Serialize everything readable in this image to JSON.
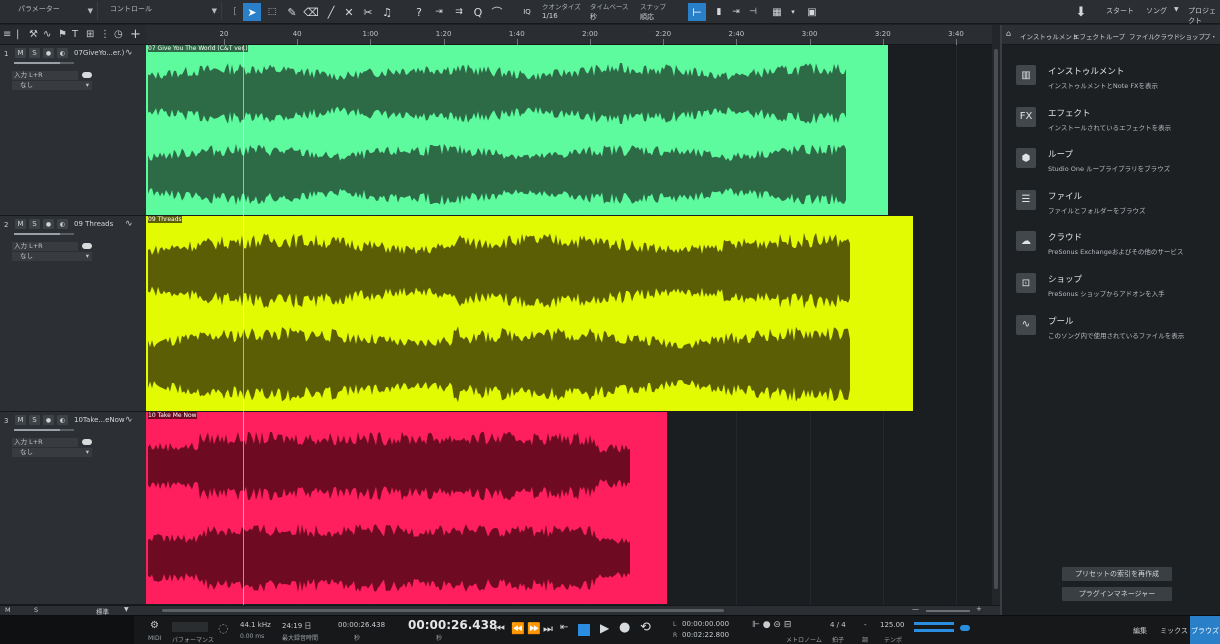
{
  "toolbar": {
    "params_label": "パラメーター",
    "control_label": "コントロール",
    "quantize_label": "クオンタイズ",
    "quantize_value": "1/16",
    "timebase_label": "タイムベース",
    "timebase_value": "秒",
    "snap_label": "スナップ",
    "snap_value": "順応",
    "iq_label": "IQ",
    "nav_start": "スタート",
    "nav_song": "ソング",
    "nav_project": "プロジェクト"
  },
  "ruler": {
    "ticks": [
      "20",
      "40",
      "1:00",
      "1:20",
      "1:40",
      "2:00",
      "2:20",
      "2:40",
      "3:00",
      "3:20",
      "3:40"
    ]
  },
  "tracks": [
    {
      "num": "1",
      "name": "07GiveYo...er.)",
      "input": "入力 L+R",
      "output": "なし",
      "clip_title": "07 Give You The World (C&T ver.)",
      "color": "#5dfa9e",
      "dark": "#2d6b47"
    },
    {
      "num": "2",
      "name": "09 Threads",
      "input": "入力 L+R",
      "output": "なし",
      "clip_title": "09 Threads",
      "color": "#e2fb02",
      "dark": "#5c5e05"
    },
    {
      "num": "3",
      "name": "10Take...eNow",
      "input": "入力 L+R",
      "output": "なし",
      "clip_title": "10 Take Me Now",
      "color": "#ff1f5e",
      "dark": "#6e0a22"
    }
  ],
  "track_buttons": {
    "mute": "M",
    "solo": "S",
    "rec": "●",
    "monitor": "◐"
  },
  "browser": {
    "tabs": [
      "インストゥルメント",
      "エフェクト",
      "ループ",
      "ファイル",
      "クラウド",
      "ショップ",
      "プ・"
    ],
    "items": [
      {
        "icon": "piano-icon",
        "title": "インストゥルメント",
        "desc": "インストゥルメントとNote FXを表示"
      },
      {
        "icon": "fx-icon",
        "title": "エフェクト",
        "desc": "インストールされているエフェクトを表示"
      },
      {
        "icon": "loop-icon",
        "title": "ループ",
        "desc": "Studio One ループライブラリをブラウズ"
      },
      {
        "icon": "file-icon",
        "title": "ファイル",
        "desc": "ファイルとフォルダーをブラウズ"
      },
      {
        "icon": "cloud-icon",
        "title": "クラウド",
        "desc": "PreSonus Exchangeおよびその他のサービス"
      },
      {
        "icon": "shop-icon",
        "title": "ショップ",
        "desc": "PreSonus ショップからアドオンを入手"
      },
      {
        "icon": "pool-icon",
        "title": "プール",
        "desc": "このソング内で使用されているファイルを表示"
      }
    ],
    "fx_glyph": "FX",
    "btn_reindex": "プリセットの索引を再作成",
    "btn_plugin_manager": "プラグインマネージャー"
  },
  "lowerbar": {
    "m": "M",
    "s": "S",
    "zoom": "標準"
  },
  "transport": {
    "midi": "MIDI",
    "performance": "パフォーマンス",
    "sample_rate": "44.1 kHz",
    "latency": "0.00 ms",
    "rec_time": "24:19 日",
    "rec_time_label": "最大録音時間",
    "pos_small": "00:00:26.438",
    "pos_small_unit": "秒",
    "pos_main": "00:00:26.438",
    "pos_main_unit": "秒",
    "loop_l": "00:00:00.000",
    "loop_r": "00:02:22.800",
    "l_label": "L",
    "r_label": "R",
    "metronome": "メトロノーム",
    "timesig": "4 / 4",
    "timesig_label": "拍子",
    "key": "-",
    "key_label": "調",
    "tempo": "125.00",
    "tempo_label": "テンポ",
    "nav_edit": "編集",
    "nav_mix": "ミックス",
    "nav_browse": "ブラウズ"
  },
  "colors": {
    "accent": "#2a7fc9"
  }
}
